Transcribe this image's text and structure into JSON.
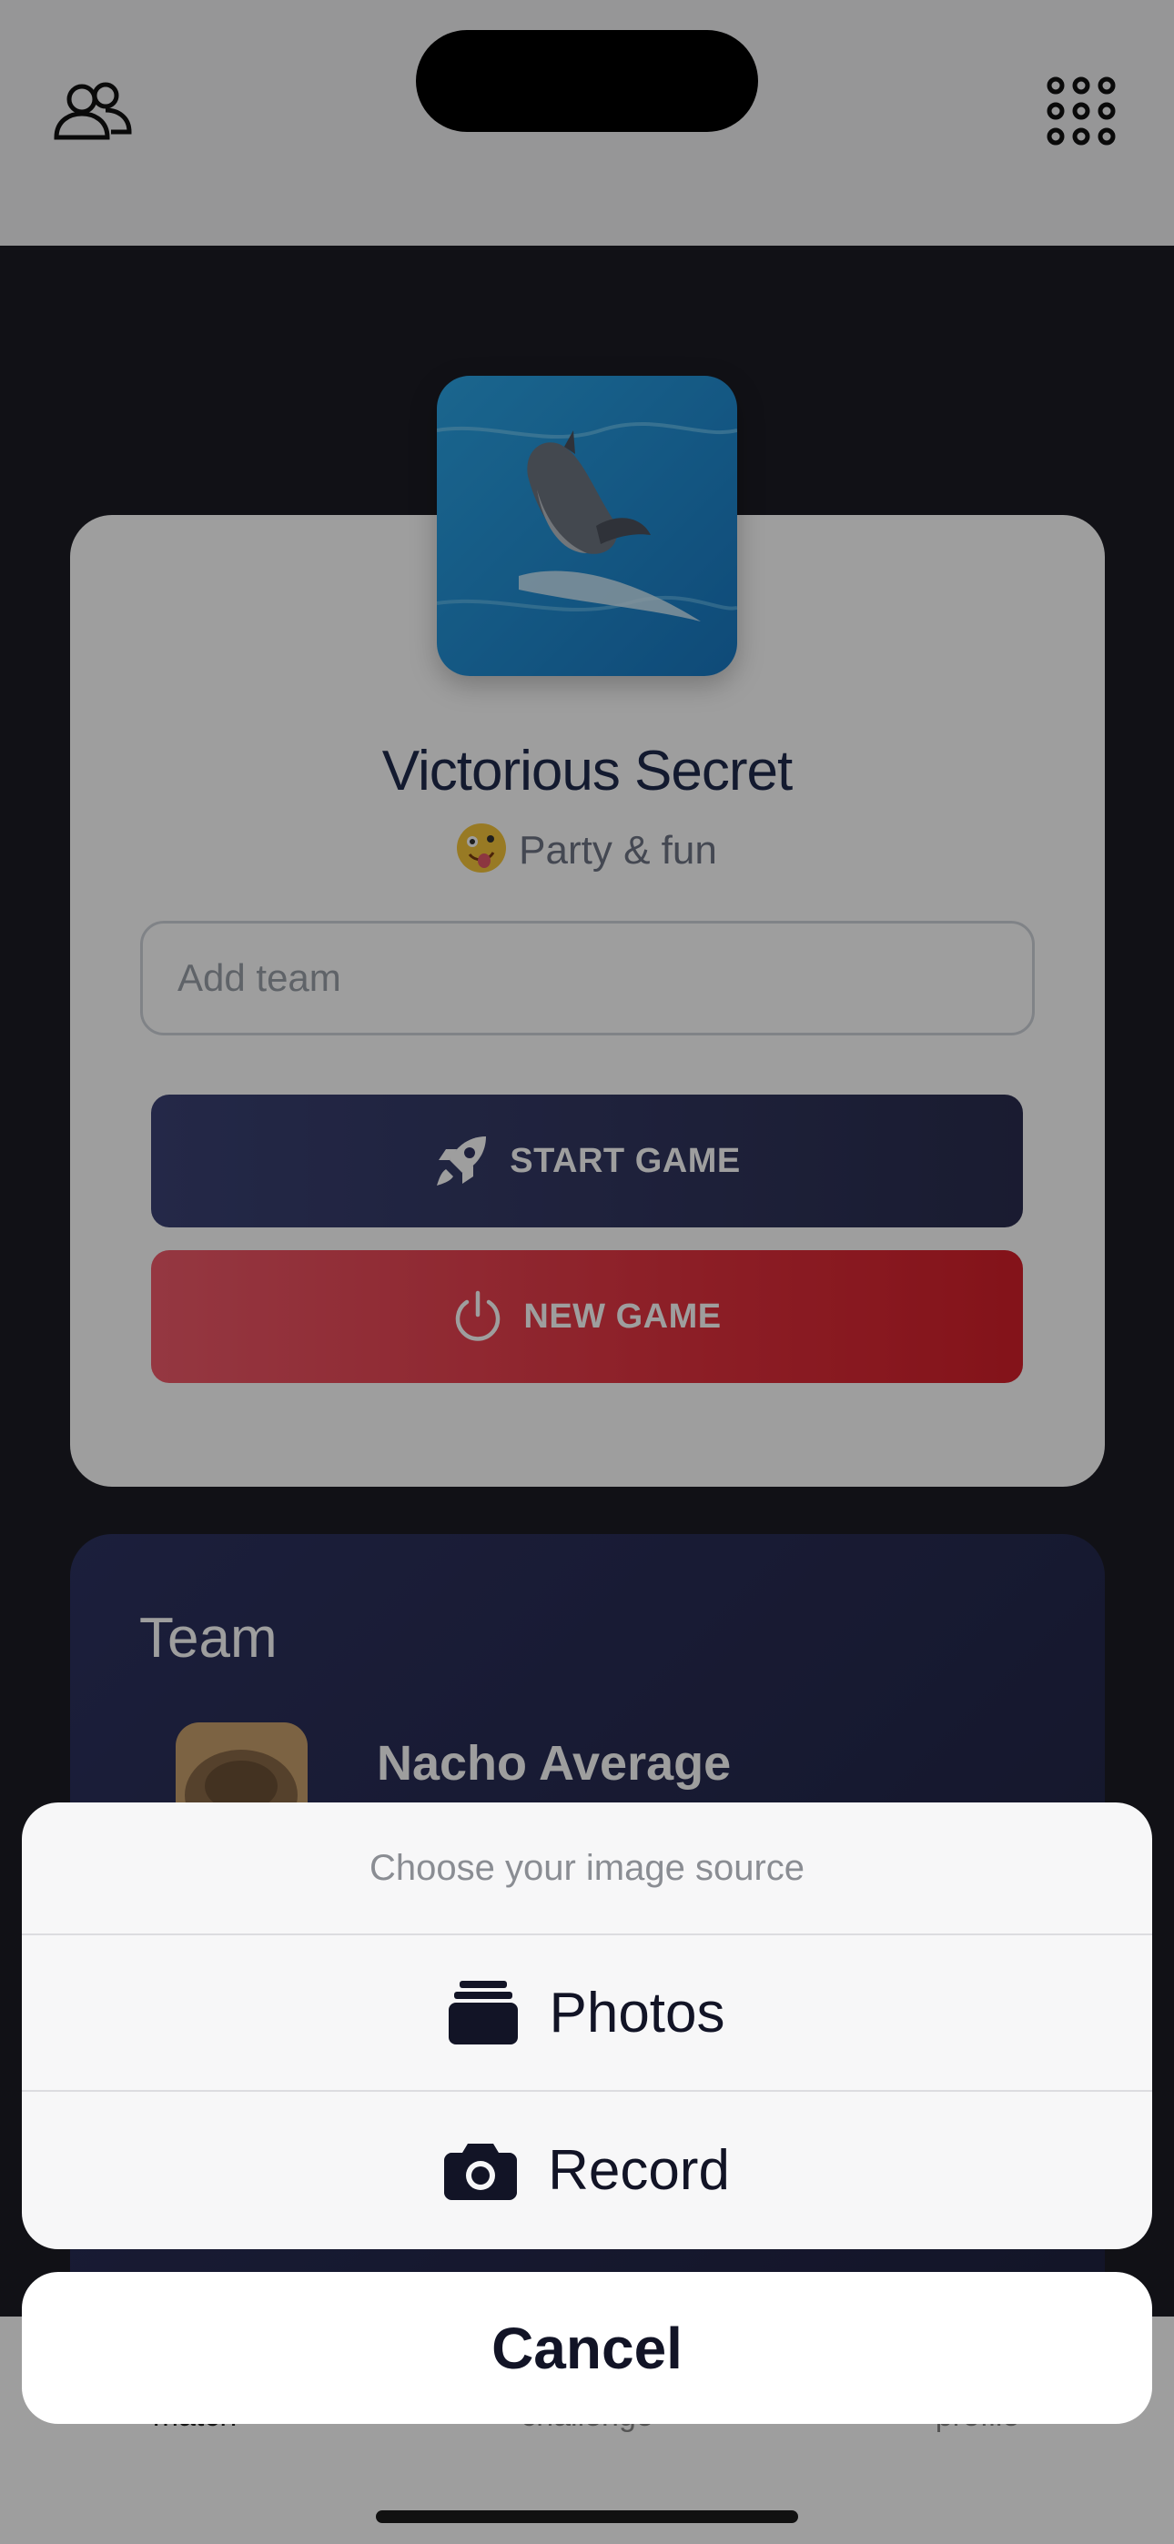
{
  "header": {
    "left_icon": "users-icon",
    "right_icon": "grid-icon"
  },
  "team_profile": {
    "name": "Victorious Secret",
    "category": "Party & fun",
    "add_team_placeholder": "Add team",
    "start_game_label": "START GAME",
    "new_game_label": "NEW GAME"
  },
  "team_section": {
    "heading": "Team",
    "members": [
      {
        "name": "Nacho Average"
      }
    ]
  },
  "tabbar": {
    "tabs": [
      "match",
      "challenge",
      "profile"
    ]
  },
  "action_sheet": {
    "title": "Choose your image source",
    "options": [
      {
        "label": "Photos",
        "icon": "photo-stack-icon"
      },
      {
        "label": "Record",
        "icon": "camera-icon"
      }
    ],
    "cancel_label": "Cancel"
  },
  "colors": {
    "navy": "#2a2d4f",
    "red": "#e3323f",
    "title": "#1f2a4d"
  }
}
